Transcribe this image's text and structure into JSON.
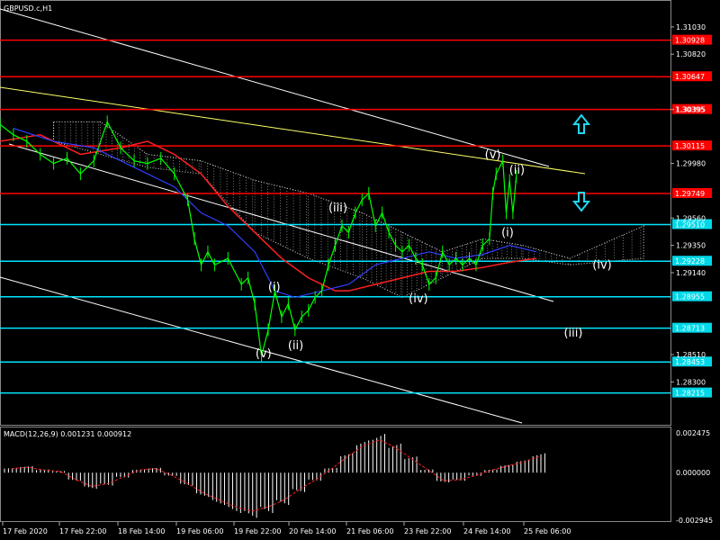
{
  "chart_title": "GBPUSD.c,H1",
  "macd_label": "MACD(12,26,9) 0.001231 0.000912",
  "price_axis": {
    "ylim": [
      1.2797,
      1.3123
    ],
    "ticks": [
      "1.31030",
      "1.30820",
      "1.30395",
      "1.29980",
      "1.29560",
      "1.29350",
      "1.29140",
      "1.28510",
      "1.28300"
    ]
  },
  "resistance_levels": [
    {
      "label": "1.30928",
      "value": 1.30928
    },
    {
      "label": "1.30647",
      "value": 1.30647
    },
    {
      "label": "1.30395",
      "value": 1.30395
    },
    {
      "label": "1.30115",
      "value": 1.30115
    },
    {
      "label": "1.29749",
      "value": 1.29749
    }
  ],
  "support_levels": [
    {
      "label": "1.29510",
      "value": 1.2951
    },
    {
      "label": "1.29228",
      "value": 1.29228
    },
    {
      "label": "1.28955",
      "value": 1.28955
    },
    {
      "label": "1.28713",
      "value": 1.28713
    },
    {
      "label": "1.28453",
      "value": 1.28453
    },
    {
      "label": "1.28215",
      "value": 1.28215
    }
  ],
  "level_colors": {
    "resistance": "#ff0000",
    "support": "#00e5ff",
    "resistance_tag_bg": "#ff0000",
    "support_tag_bg": "#00d8e8"
  },
  "macd_axis": {
    "ylim": [
      -0.003,
      0.0028
    ],
    "ticks": [
      "0.002475",
      "0.000000",
      "-0.002945"
    ]
  },
  "time_axis": [
    "17 Feb 2020",
    "17 Feb 22:00",
    "18 Feb 14:00",
    "19 Feb 06:00",
    "19 Feb 22:00",
    "20 Feb 14:00",
    "21 Feb 06:00",
    "23 Feb 22:00",
    "24 Feb 14:00",
    "25 Feb 06:00"
  ],
  "wave_labels": [
    {
      "text": "(v)",
      "x": 0.393,
      "y": 1.2849
    },
    {
      "text": "(i)",
      "x": 0.409,
      "y": 1.29
    },
    {
      "text": "(ii)",
      "x": 0.441,
      "y": 1.2855
    },
    {
      "text": "(iii)",
      "x": 0.504,
      "y": 1.2961
    },
    {
      "text": "(iv)",
      "x": 0.624,
      "y": 1.2891
    },
    {
      "text": "(v)",
      "x": 0.735,
      "y": 1.3002
    },
    {
      "text": "(ii)",
      "x": 0.771,
      "y": 1.299
    },
    {
      "text": "(i)",
      "x": 0.757,
      "y": 1.2942
    },
    {
      "text": "(iv)",
      "x": 0.898,
      "y": 1.2917
    },
    {
      "text": "(iii)",
      "x": 0.855,
      "y": 1.2865
    }
  ],
  "chart_data": {
    "type": "line",
    "title": "GBPUSD.c,H1",
    "ylim": [
      1.2797,
      1.3123
    ],
    "series": [
      {
        "x": [
          0.0,
          0.02,
          0.04,
          0.06,
          0.08,
          0.1,
          0.12,
          0.14,
          0.16,
          0.18,
          0.2,
          0.22,
          0.24,
          0.26,
          0.28,
          0.29,
          0.3,
          0.31,
          0.32,
          0.34,
          0.36,
          0.37,
          0.38,
          0.39,
          0.4,
          0.41,
          0.42,
          0.43,
          0.44,
          0.45,
          0.46,
          0.47,
          0.48,
          0.49,
          0.5,
          0.51,
          0.52,
          0.53,
          0.54,
          0.55,
          0.56,
          0.57,
          0.58,
          0.59,
          0.6,
          0.61,
          0.62,
          0.63,
          0.64,
          0.65,
          0.66,
          0.67,
          0.68,
          0.69,
          0.7,
          0.71,
          0.72,
          0.73,
          0.735,
          0.74,
          0.75,
          0.755,
          0.76,
          0.765,
          0.77
        ],
        "values": [
          1.3028,
          1.302,
          1.3015,
          1.3005,
          1.2998,
          1.3002,
          1.299,
          1.3,
          1.303,
          1.301,
          1.3,
          1.2998,
          1.3002,
          1.299,
          1.297,
          1.294,
          1.292,
          1.293,
          1.292,
          1.2925,
          1.2905,
          1.291,
          1.289,
          1.285,
          1.287,
          1.29,
          1.288,
          1.289,
          1.287,
          1.288,
          1.2885,
          1.2895,
          1.29,
          1.292,
          1.2935,
          1.295,
          1.2945,
          1.296,
          1.297,
          1.2975,
          1.295,
          1.296,
          1.2945,
          1.2935,
          1.293,
          1.2935,
          1.2925,
          1.292,
          1.2905,
          1.291,
          1.293,
          1.292,
          1.2925,
          1.292,
          1.2925,
          1.292,
          1.2935,
          1.294,
          1.2975,
          1.299,
          1.3,
          1.296,
          1.2985,
          1.296,
          1.2988
        ]
      }
    ]
  },
  "colors": {
    "bg": "#000000",
    "price": "#00ff00",
    "ema_red": "#ff2020",
    "ema_blue": "#3040ff",
    "trend_white": "#ffffff",
    "trend_yellow": "#ffff66",
    "arrow": "#20d8f0"
  }
}
